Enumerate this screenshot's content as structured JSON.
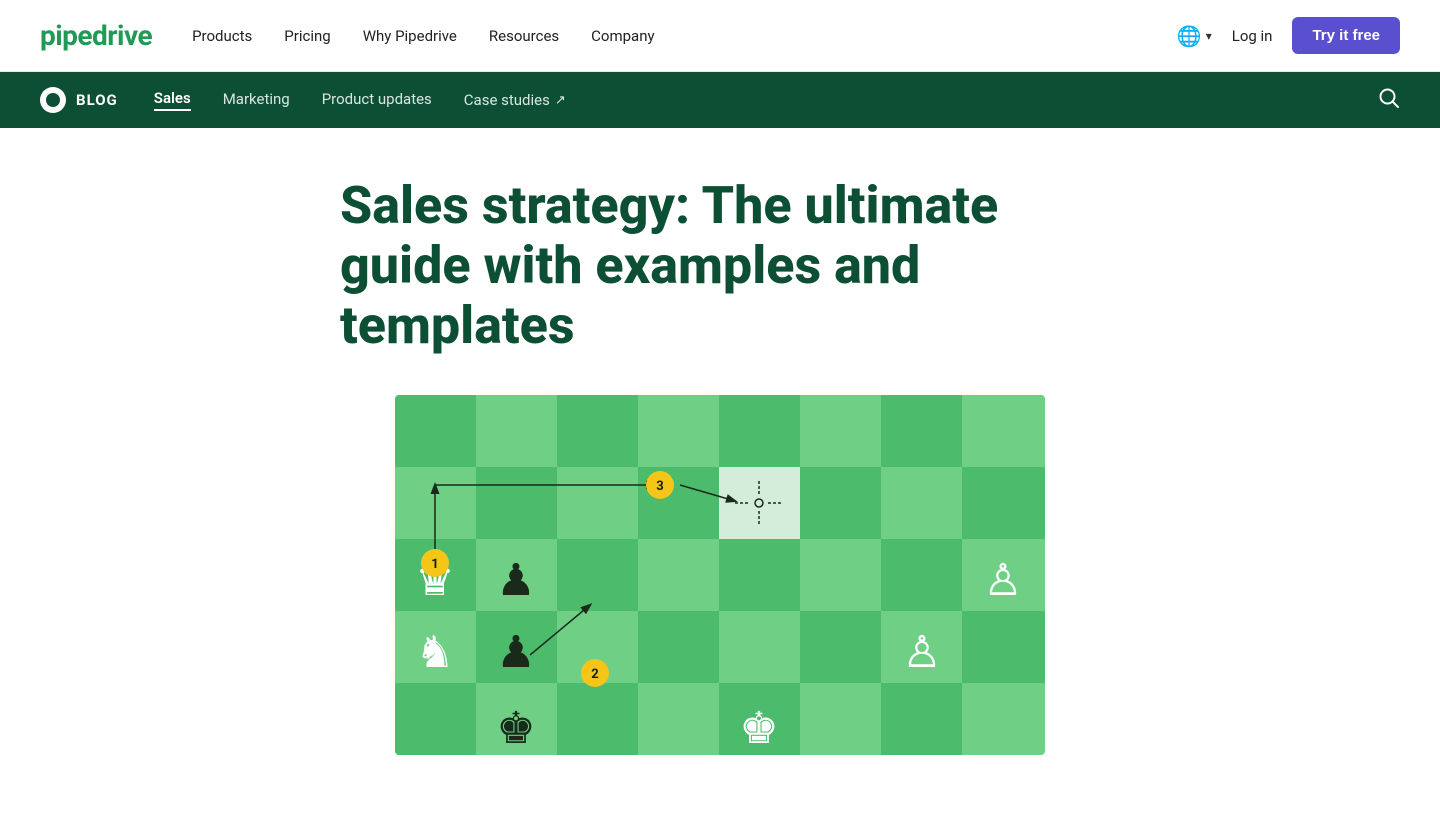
{
  "brand": {
    "logo": "pipedrive",
    "color": "#1f9b55"
  },
  "topnav": {
    "links": [
      {
        "label": "Products",
        "id": "products"
      },
      {
        "label": "Pricing",
        "id": "pricing"
      },
      {
        "label": "Why Pipedrive",
        "id": "why"
      },
      {
        "label": "Resources",
        "id": "resources"
      },
      {
        "label": "Company",
        "id": "company"
      }
    ],
    "login_label": "Log in",
    "try_free_label": "Try it free"
  },
  "blognav": {
    "logo_label": "BLOG",
    "links": [
      {
        "label": "Sales",
        "active": true
      },
      {
        "label": "Marketing",
        "active": false
      },
      {
        "label": "Product updates",
        "active": false
      },
      {
        "label": "Case studies",
        "active": false,
        "external": true
      }
    ]
  },
  "article": {
    "title": "Sales strategy: The ultimate guide with examples and templates"
  }
}
